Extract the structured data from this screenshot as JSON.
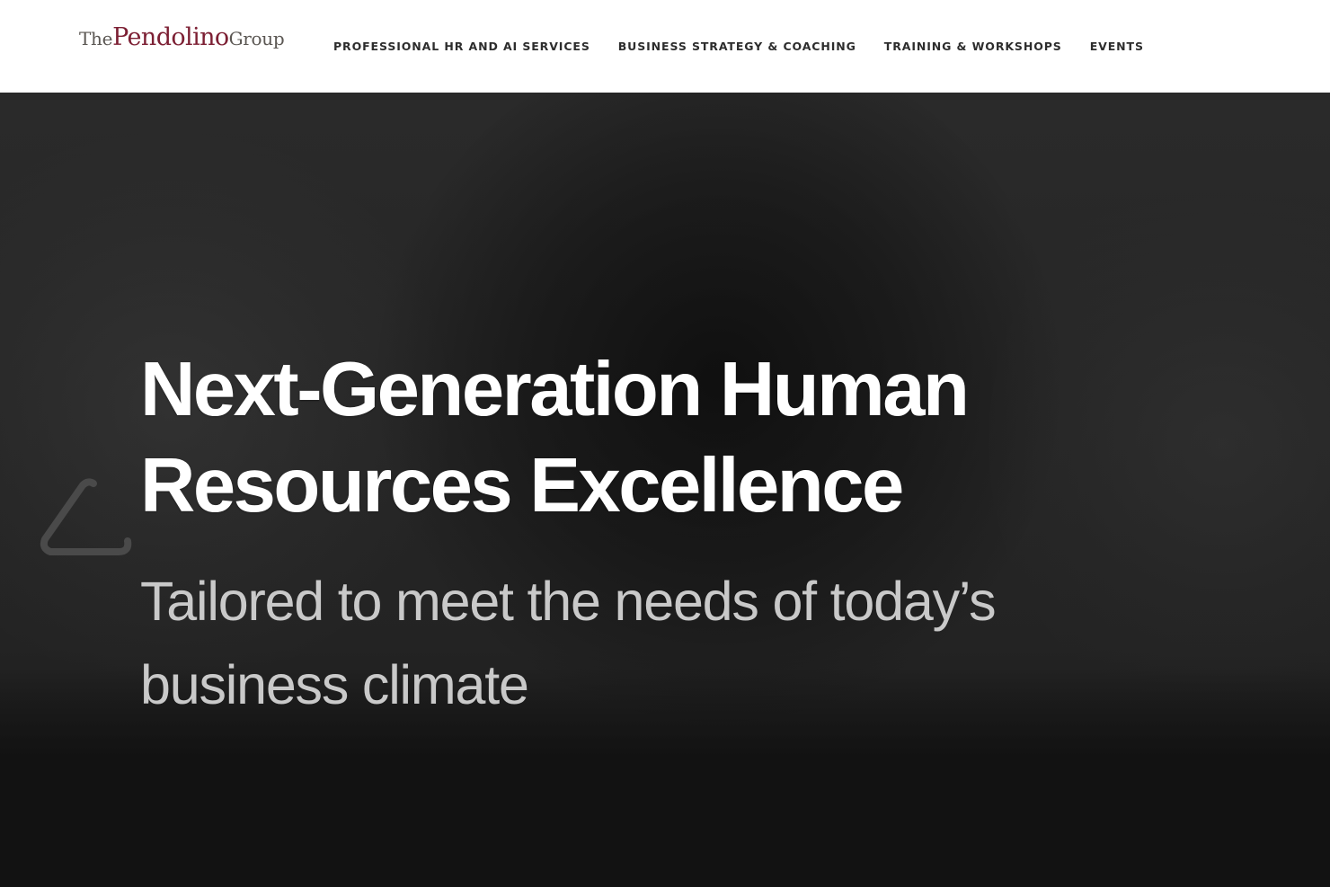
{
  "header": {
    "logo": {
      "the": "The",
      "pendolino": "Pendolino",
      "group": "Group"
    },
    "nav": [
      {
        "label": "PROFESSIONAL HR AND AI SERVICES"
      },
      {
        "label": "BUSINESS STRATEGY & COACHING"
      },
      {
        "label": "TRAINING & WORKSHOPS"
      },
      {
        "label": "EVENTS"
      }
    ]
  },
  "hero": {
    "title_line1": "Next-Generation Human",
    "title_line2": "Resources Excellence",
    "subtitle_line1": "Tailored to meet the needs of today’s",
    "subtitle_line2": "business climate",
    "prev_icon": "chevron-left-icon"
  },
  "colors": {
    "header_bg": "#ffffff",
    "logo_brand": "#7c1f33",
    "logo_gray": "#5b5753",
    "nav_text": "#2d2d2d",
    "hero_title": "#ffffff",
    "hero_subtitle": "#c9c9c9",
    "hero_bg": "#242424"
  }
}
